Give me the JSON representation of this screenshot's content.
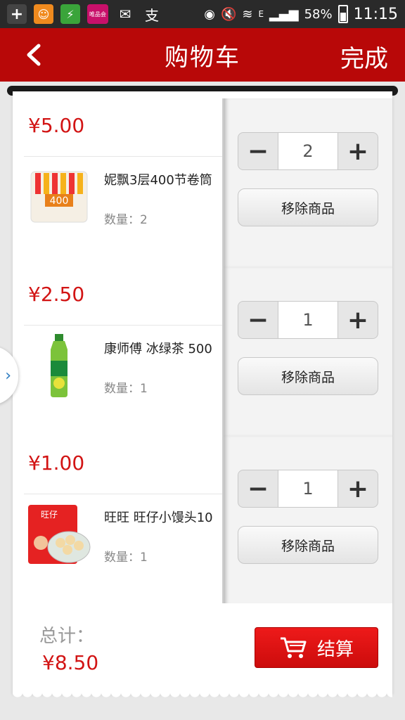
{
  "status_bar": {
    "battery": "58%",
    "time": "11:15",
    "network": "E",
    "app_badge": "唯品会"
  },
  "header": {
    "title": "购物车",
    "done_label": "完成"
  },
  "items": [
    {
      "price": "¥5.00",
      "name": "妮飘3层400节卷筒",
      "quantity_label": "数量：2",
      "quantity": "2",
      "remove_label": "移除商品"
    },
    {
      "price": "¥2.50",
      "name": "康师傅 冰绿茶 500",
      "quantity_label": "数量：1",
      "quantity": "1",
      "remove_label": "移除商品"
    },
    {
      "price": "¥1.00",
      "name": "旺旺 旺仔小馒头10",
      "quantity_label": "数量：1",
      "quantity": "1",
      "remove_label": "移除商品"
    }
  ],
  "stepper": {
    "minus": "−",
    "plus": "+"
  },
  "thumb_labels": {
    "paper": "400",
    "wangzai": "旺仔"
  },
  "footer": {
    "total_label": "总计：",
    "total_value": "¥8.50",
    "checkout_label": "结算"
  },
  "colors": {
    "brand_red": "#b80808",
    "price_red": "#d21414"
  }
}
